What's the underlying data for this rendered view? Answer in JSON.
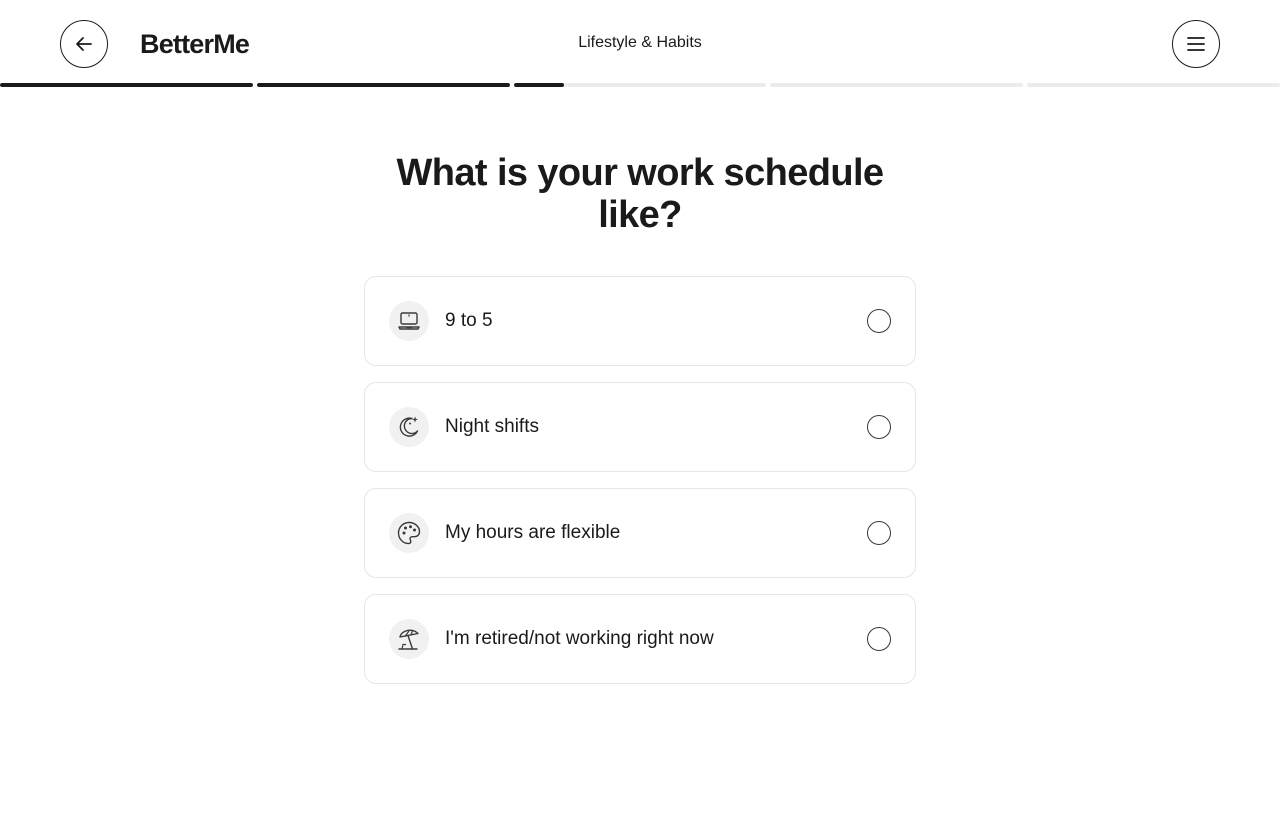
{
  "header": {
    "logo": "BetterMe",
    "section_title": "Lifestyle & Habits",
    "back_icon": "arrow-left-icon",
    "menu_icon": "hamburger-menu-icon"
  },
  "progress": {
    "segments": 5,
    "fill_fractions": [
      1,
      1,
      0.2,
      0,
      0
    ]
  },
  "question": "What is your work schedule like?",
  "options": [
    {
      "label": "9 to 5",
      "icon": "laptop-icon"
    },
    {
      "label": "Night shifts",
      "icon": "moon-sparkle-icon"
    },
    {
      "label": "My hours are flexible",
      "icon": "palette-icon"
    },
    {
      "label": "I'm retired/not working right now",
      "icon": "beach-umbrella-icon"
    }
  ],
  "colors": {
    "text": "#1a1a1a",
    "border": "#e6e6e6",
    "icon_bg": "#f1f1f1",
    "progress_track": "#ececec",
    "progress_fill": "#1a1a1a"
  }
}
